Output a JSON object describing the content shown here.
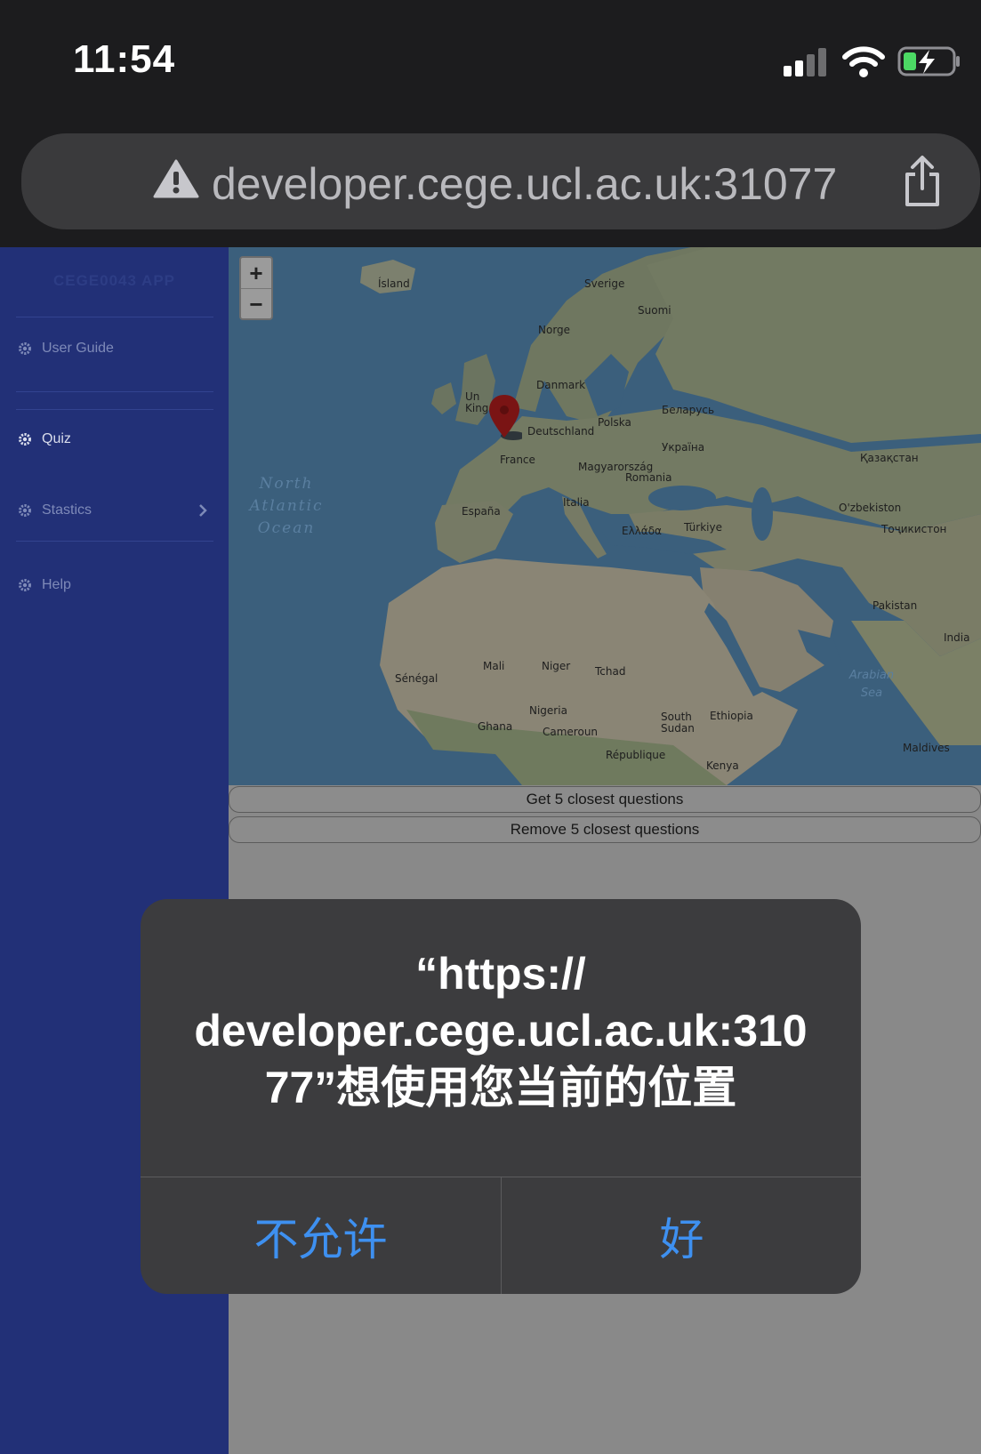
{
  "status_bar": {
    "time": "11:54"
  },
  "url_bar": {
    "url": "developer.cege.ucl.ac.uk:31077"
  },
  "sidebar": {
    "brand": "CEGE0043 APP",
    "items": [
      {
        "label": "User Guide"
      },
      {
        "label": "Quiz"
      },
      {
        "label": "Stastics"
      },
      {
        "label": "Help"
      }
    ]
  },
  "map": {
    "zoom_in": "+",
    "zoom_out": "−",
    "ocean_label": "North Atlantic Ocean",
    "labels": [
      "Ísland",
      "Sverige",
      "Suomi",
      "Norge",
      "Danmark",
      "Un King",
      "Polska",
      "Беларусь",
      "Deutschland",
      "Україна",
      "France",
      "Magyarország",
      "Romania",
      "Қазақстан",
      "Italia",
      "España",
      "Ελλάδα",
      "Türkiye",
      "O'zbekiston",
      "Тоҷикистон",
      "Pakistan",
      "India",
      "Mali",
      "Niger",
      "Tchad",
      "Sénégal",
      "Nigeria",
      "Ghana",
      "Cameroun",
      "South Sudan",
      "Ethiopia",
      "Maldives",
      "Arabian Sea",
      "Kenya",
      "République"
    ]
  },
  "buttons": {
    "get_closest": "Get 5 closest questions",
    "remove_closest": "Remove 5 closest questions"
  },
  "alert": {
    "title_line1": "“https://",
    "title_line2": "developer.cege.ucl.ac.uk:310",
    "title_line3": "77”想使用您当前的位置",
    "deny": "不允许",
    "allow": "好"
  },
  "colors": {
    "sidebar": "#223077",
    "alert_button": "#3e90f0",
    "overlay_dim": "#898989"
  }
}
